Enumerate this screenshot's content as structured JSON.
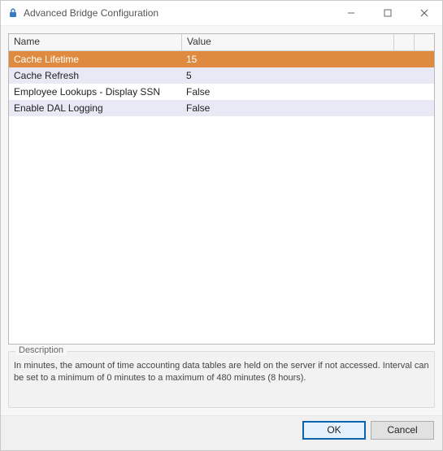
{
  "window": {
    "title": "Advanced Bridge Configuration"
  },
  "grid": {
    "columns": {
      "name": "Name",
      "value": "Value"
    },
    "rows": [
      {
        "name": "Cache Lifetime",
        "value": "15",
        "selected": true
      },
      {
        "name": "Cache Refresh",
        "value": "5",
        "zebra": true
      },
      {
        "name": "Employee Lookups - Display SSN",
        "value": "False"
      },
      {
        "name": "Enable DAL Logging",
        "value": "False",
        "zebra": true
      }
    ]
  },
  "description": {
    "legend": "Description",
    "text": "In minutes, the amount of time accounting data tables are held on the server if not accessed. Interval can be set to a minimum of 0 minutes to a maximum of 480 minutes (8 hours)."
  },
  "buttons": {
    "ok": "OK",
    "cancel": "Cancel"
  }
}
